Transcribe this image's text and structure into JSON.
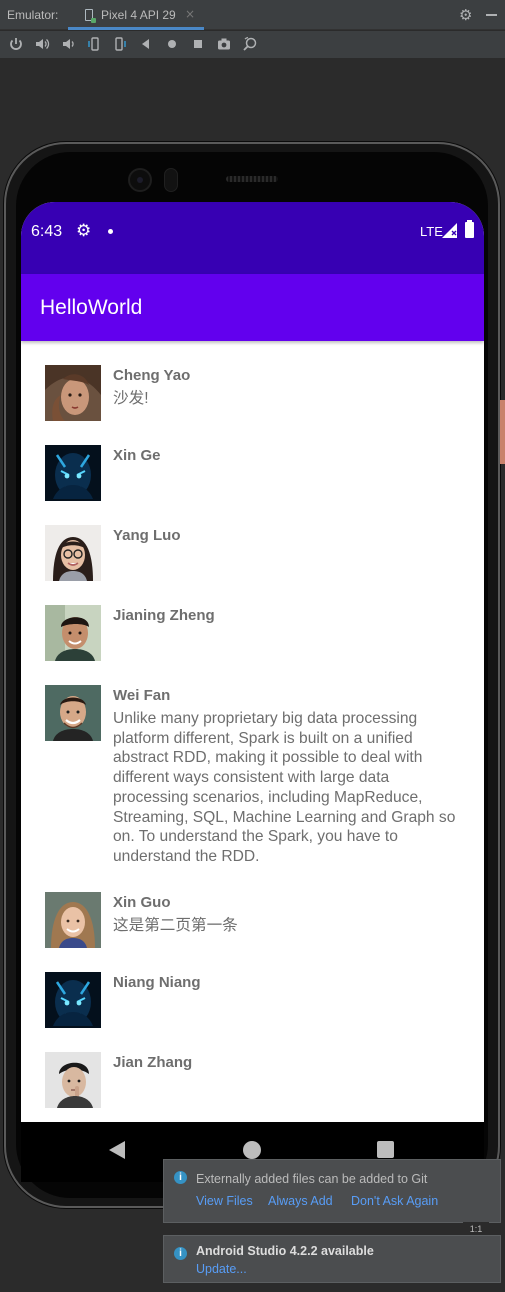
{
  "emulator": {
    "label": "Emulator:",
    "device_tab": "Pixel 4 API 29",
    "tab_close": "×"
  },
  "toolbar": {
    "buttons": [
      "power-icon",
      "volume-up-icon",
      "volume-down-icon",
      "rotate-left-icon",
      "rotate-right-icon",
      "back-icon",
      "home-icon",
      "overview-icon",
      "screenshot-icon",
      "zoom-icon"
    ]
  },
  "status_bar": {
    "time": "6:43",
    "network": "LTE"
  },
  "app": {
    "title": "HelloWorld",
    "primary_color": "#6200ee",
    "status_color": "#3700b3"
  },
  "contacts": [
    {
      "name": "Cheng Yao",
      "message": "沙发!"
    },
    {
      "name": "Xin Ge",
      "message": ""
    },
    {
      "name": "Yang Luo",
      "message": ""
    },
    {
      "name": "Jianing Zheng",
      "message": ""
    },
    {
      "name": "Wei Fan",
      "message": "Unlike many proprietary big data processing platform different, Spark is built on a unified abstract RDD, making it possible to deal with different ways consistent with large data processing scenarios, including MapReduce, Streaming, SQL, Machine Learning and Graph so on. To understand the Spark, you have to understand the RDD."
    },
    {
      "name": "Xin Guo",
      "message": "这是第二页第一条"
    },
    {
      "name": "Niang Niang",
      "message": ""
    },
    {
      "name": "Jian Zhang",
      "message": ""
    }
  ],
  "notifications": {
    "git": {
      "text": "Externally added files can be added to Git",
      "view_files": "View Files",
      "always_add": "Always Add",
      "dont_ask": "Don't Ask Again"
    },
    "update": {
      "title": "Android Studio 4.2.2 available",
      "link": "Update..."
    }
  },
  "zoom_label": "1:1"
}
